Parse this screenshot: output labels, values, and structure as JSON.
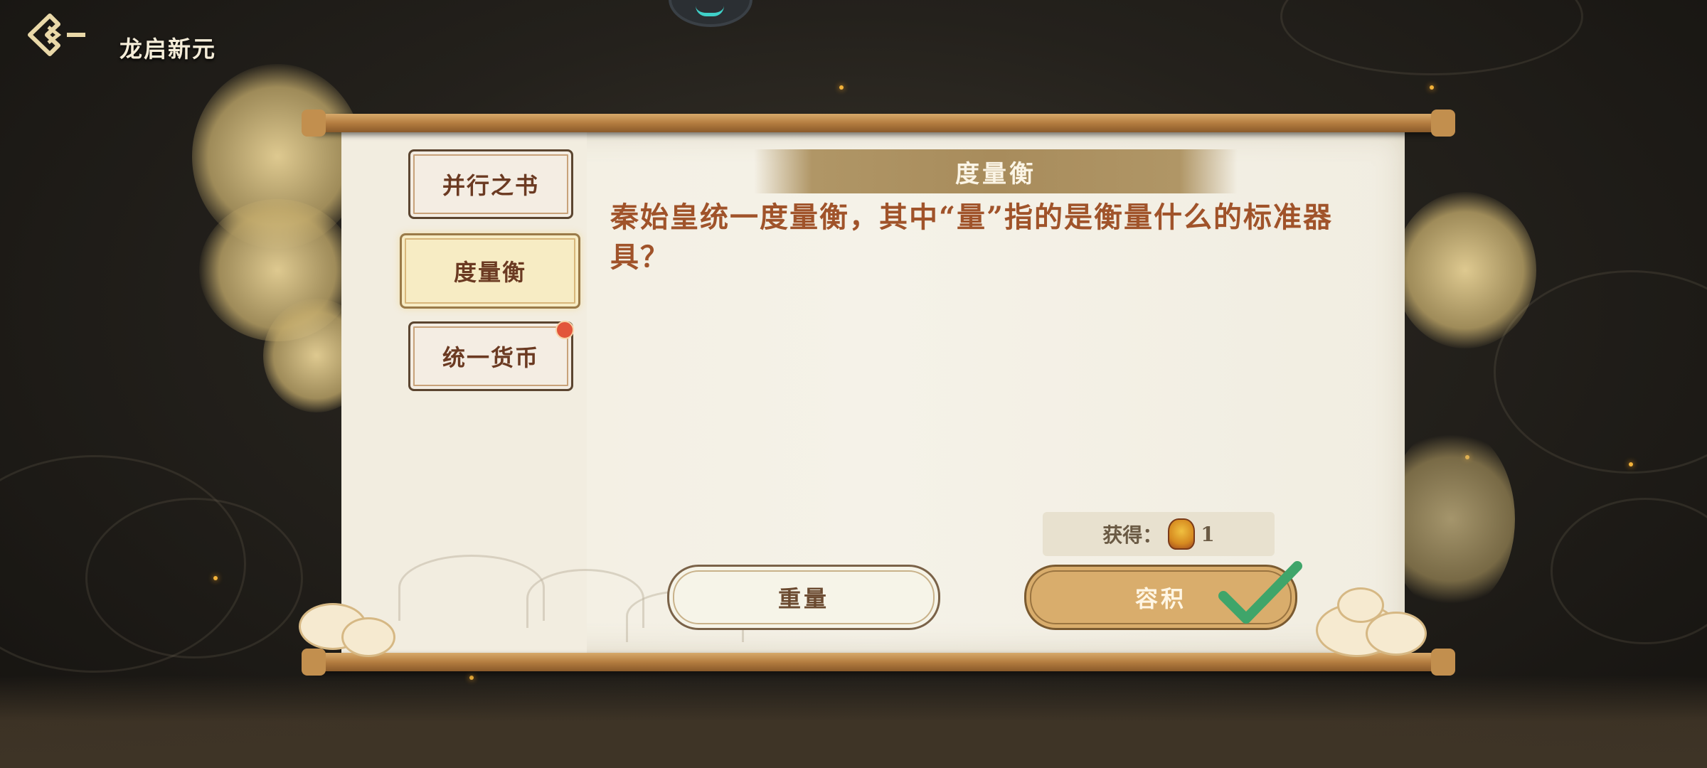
{
  "header": {
    "title": "龙启新元"
  },
  "scroll": {
    "tabs": [
      {
        "label": "并行之书",
        "active": false,
        "badge": false
      },
      {
        "label": "度量衡",
        "active": true,
        "badge": false
      },
      {
        "label": "统一货币",
        "active": false,
        "badge": true
      }
    ],
    "banner_title": "度量衡",
    "question": "秦始皇统一度量衡，其中“量”指的是衡量什么的标准器具？",
    "reward": {
      "label": "获得：",
      "count": "1",
      "icon": "character-token-icon"
    },
    "answers": [
      {
        "label": "重量",
        "selected": false
      },
      {
        "label": "容积",
        "selected": true,
        "correct": true
      }
    ]
  },
  "colors": {
    "question_text": "#a0532a",
    "correct_check": "#3fa56a",
    "badge": "#e2553a"
  }
}
